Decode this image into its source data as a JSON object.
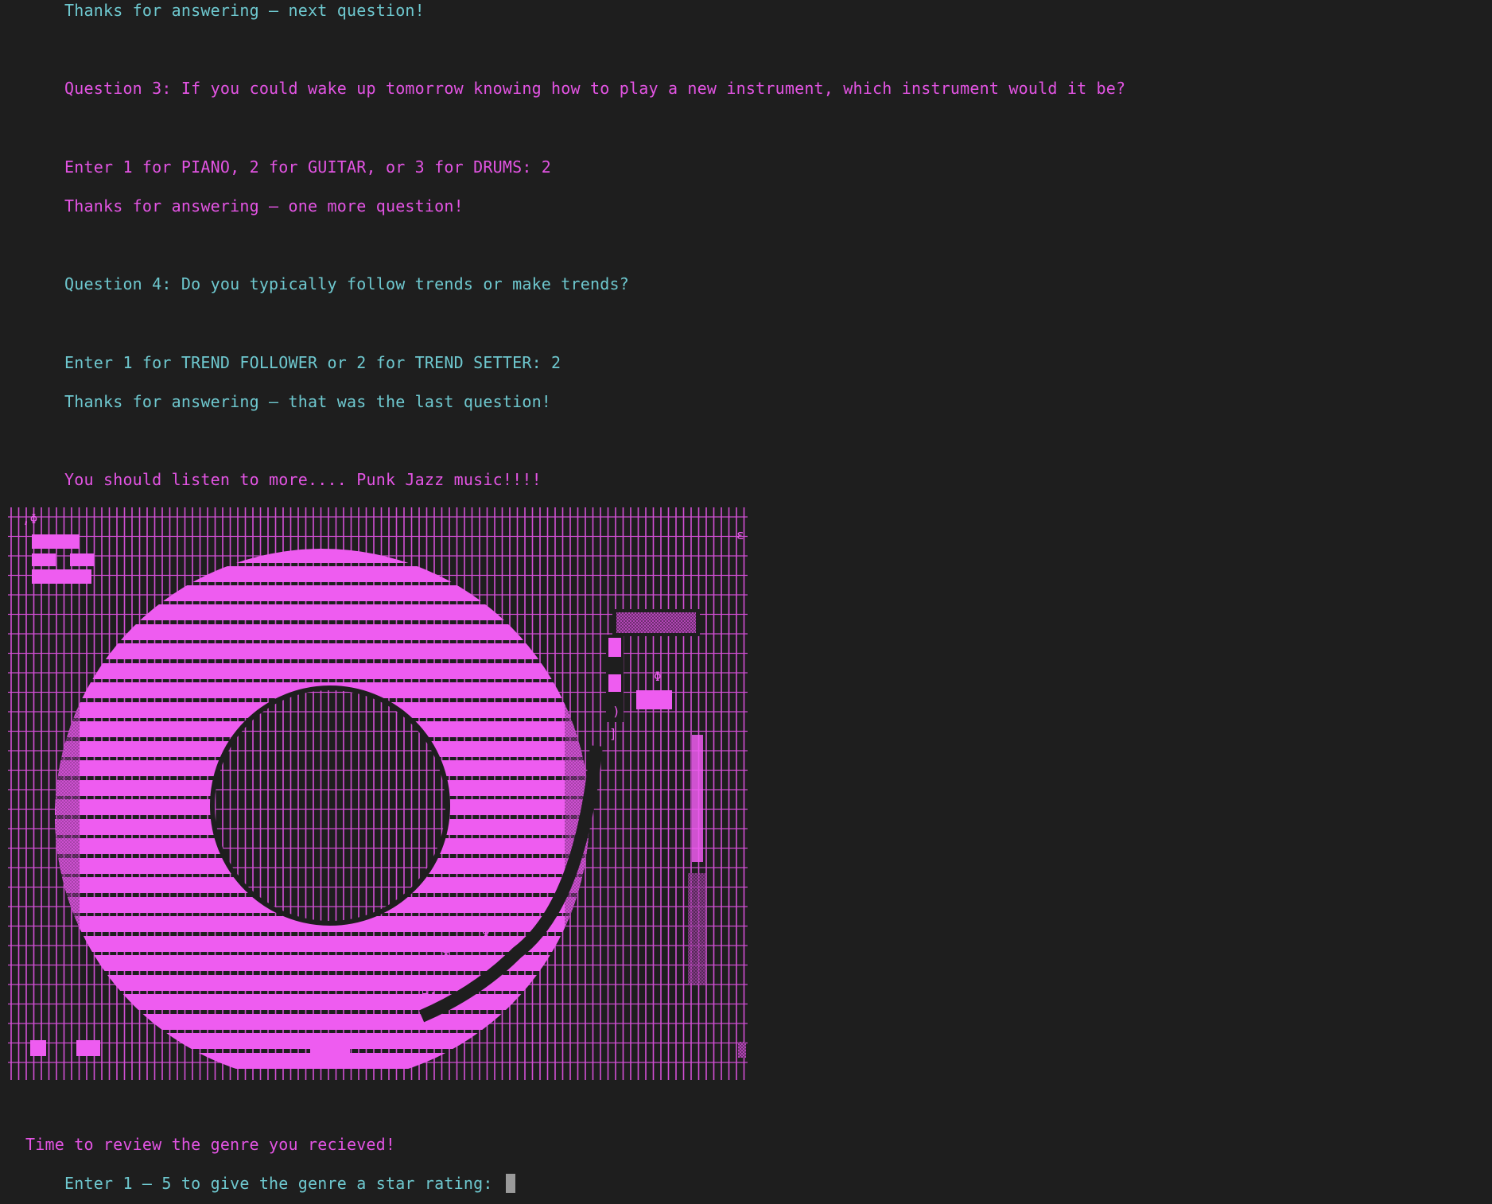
{
  "lines": {
    "thanks_next": "Thanks for answering – next question!",
    "q3": "Question 3: If you could wake up tomorrow knowing how to play a new instrument, which instrument would it be?",
    "q3_prompt": "Enter 1 for PIANO, 2 for GUITAR, or 3 for DRUMS: 2",
    "thanks_one_more": "Thanks for answering – one more question!",
    "q4": "Question 4: Do you typically follow trends or make trends?",
    "q4_prompt": "Enter 1 for TREND FOLLOWER or 2 for TREND SETTER: 2",
    "thanks_last": "Thanks for answering – that was the last question!",
    "result": "You should listen to more.... Punk Jazz music!!!!",
    "review": "Time to review the genre you recieved!",
    "rating_prompt": "Enter 1 – 5 to give the genre a star rating: "
  },
  "colors": {
    "background": "#1e1e1e",
    "cyan": "#6ec8cf",
    "magenta": "#e354e3",
    "art_bright": "#ee5cf0",
    "art_dim": "#a33ea6",
    "cursor": "#9a9a9a"
  },
  "art": {
    "subject": "record-with-music-note",
    "glyphs": [
      "Φ",
      "ε",
      ")",
      "]",
      "~",
      "⌂"
    ]
  }
}
